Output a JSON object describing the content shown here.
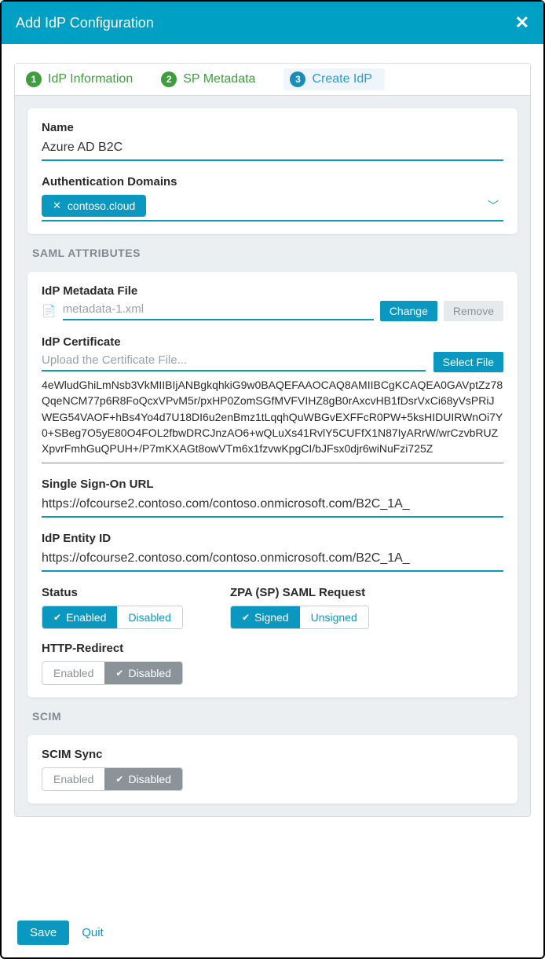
{
  "dialog": {
    "title": "Add IdP Configuration"
  },
  "steps": {
    "s1": "IdP Information",
    "s2": "SP Metadata",
    "s3": "Create IdP"
  },
  "form": {
    "name_label": "Name",
    "name_value": "Azure AD B2C",
    "auth_domains_label": "Authentication Domains",
    "auth_domain_tag": "contoso.cloud"
  },
  "saml": {
    "section": "SAML ATTRIBUTES",
    "metadata_label": "IdP Metadata File",
    "metadata_file": "metadata-1.xml",
    "change": "Change",
    "remove": "Remove",
    "cert_label": "IdP Certificate",
    "cert_placeholder": "Upload the Certificate File...",
    "select_file": "Select File",
    "cert_text": "4eWludGhiLmNsb3VkMIIBIjANBgkqhkiG9w0BAQEFAAOCAQ8AMIIBCgKCAQEA0GAVptZz78QqeNCM77p6R8FoQcxVPvM5r/pxHP0ZomSGfMVFVIHZ8gB0rAxcvHB1fDsrVxCi68yVsPRiJWEG54VAOF+hBs4Yo4d7U18DI6u2enBmz1tLqqhQuWBGvEXFFcR0PW+5ksHIDUIRWnOi7Y0+SBeg7O5yE80O4FOL2fbwDRCJnzAO6+wQLuXs41RvlY5CUFfX1N87IyARrW/wrCzvbRUZXpvrFmhGuQPUH+/P7mKXAGt8owVTm6x1fzvwKpgCI/bJFsx0djr6wiNuFzi725Z",
    "sso_label": "Single Sign-On URL",
    "sso_value": "https://ofcourse2.contoso.com/contoso.onmicrosoft.com/B2C_1A_",
    "entity_label": "IdP Entity ID",
    "entity_value": "https://ofcourse2.contoso.com/contoso.onmicrosoft.com/B2C_1A_",
    "status_label": "Status",
    "enabled": "Enabled",
    "disabled": "Disabled",
    "zpa_label": "ZPA (SP) SAML Request",
    "signed": "Signed",
    "unsigned": "Unsigned",
    "http_redirect_label": "HTTP-Redirect"
  },
  "scim": {
    "section": "SCIM",
    "sync_label": "SCIM Sync",
    "enabled": "Enabled",
    "disabled": "Disabled"
  },
  "footer": {
    "save": "Save",
    "quit": "Quit"
  }
}
